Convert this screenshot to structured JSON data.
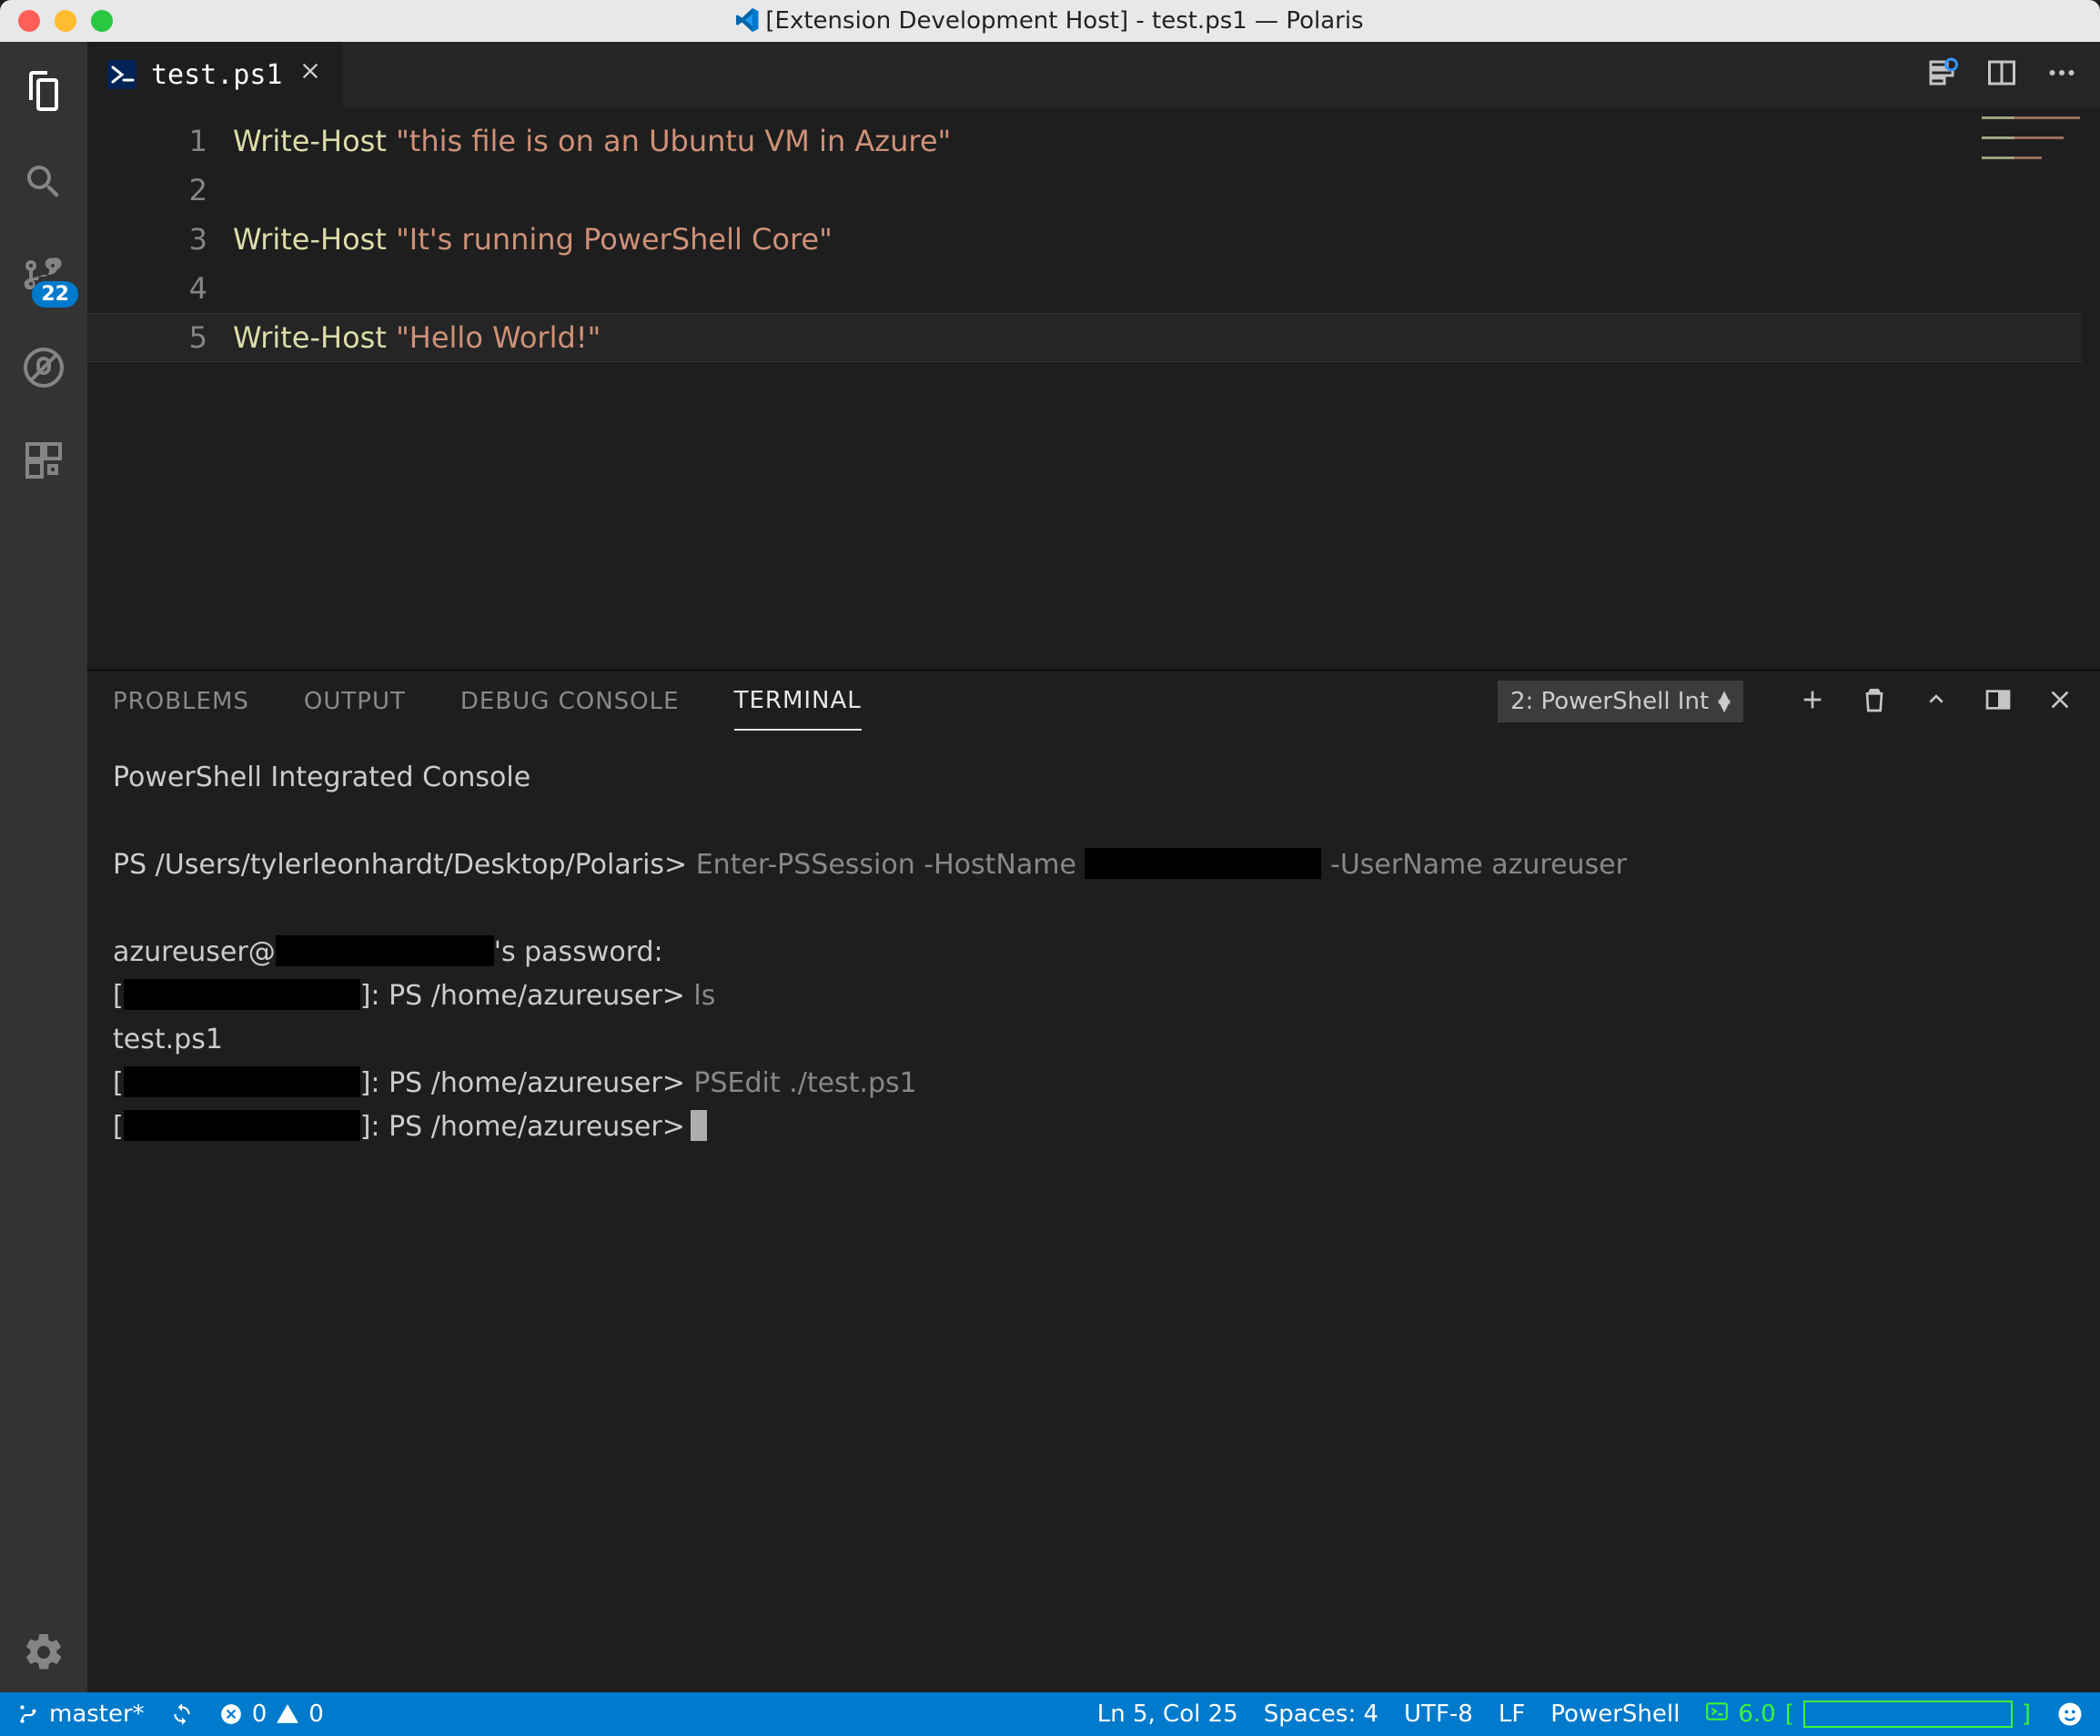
{
  "window": {
    "title": "[Extension Development Host] - test.ps1 — Polaris"
  },
  "activitybar": {
    "scm_badge": "22"
  },
  "tab": {
    "filename": "test.ps1"
  },
  "editor": {
    "line_numbers": [
      "1",
      "2",
      "3",
      "4",
      "5"
    ],
    "lines": [
      {
        "cmd": "Write-Host",
        "str": "\"this file is on an Ubuntu VM in Azure\""
      },
      {
        "cmd": "",
        "str": ""
      },
      {
        "cmd": "Write-Host",
        "str": "\"It's running PowerShell Core\""
      },
      {
        "cmd": "",
        "str": ""
      },
      {
        "cmd": "Write-Host",
        "str": "\"Hello World!\""
      }
    ],
    "current_line_index": 4
  },
  "panel": {
    "tabs": {
      "problems": "PROBLEMS",
      "output": "OUTPUT",
      "debug": "DEBUG CONSOLE",
      "terminal": "TERMINAL"
    },
    "terminal_selector": "2: PowerShell Int"
  },
  "terminal": {
    "banner": "PowerShell Integrated Console",
    "prompt1_pre": "PS /Users/tylerleonhardt/Desktop/Polaris>",
    "prompt1_cmd": "Enter-PSSession -HostName",
    "prompt1_cmd2": "-UserName azureuser",
    "pw_pre": "azureuser@",
    "pw_post": "'s password:",
    "rp_prefix_l": "[",
    "rp_prefix_r": "]: PS /home/azureuser>",
    "cmd_ls": "ls",
    "ls_out": "test.ps1",
    "cmd_psedit": "PSEdit ./test.ps1"
  },
  "statusbar": {
    "branch": "master*",
    "errors": "0",
    "warnings": "0",
    "position": "Ln 5, Col 25",
    "spaces": "Spaces: 4",
    "encoding": "UTF-8",
    "eol": "LF",
    "language": "PowerShell",
    "ps_version": "6.0"
  }
}
